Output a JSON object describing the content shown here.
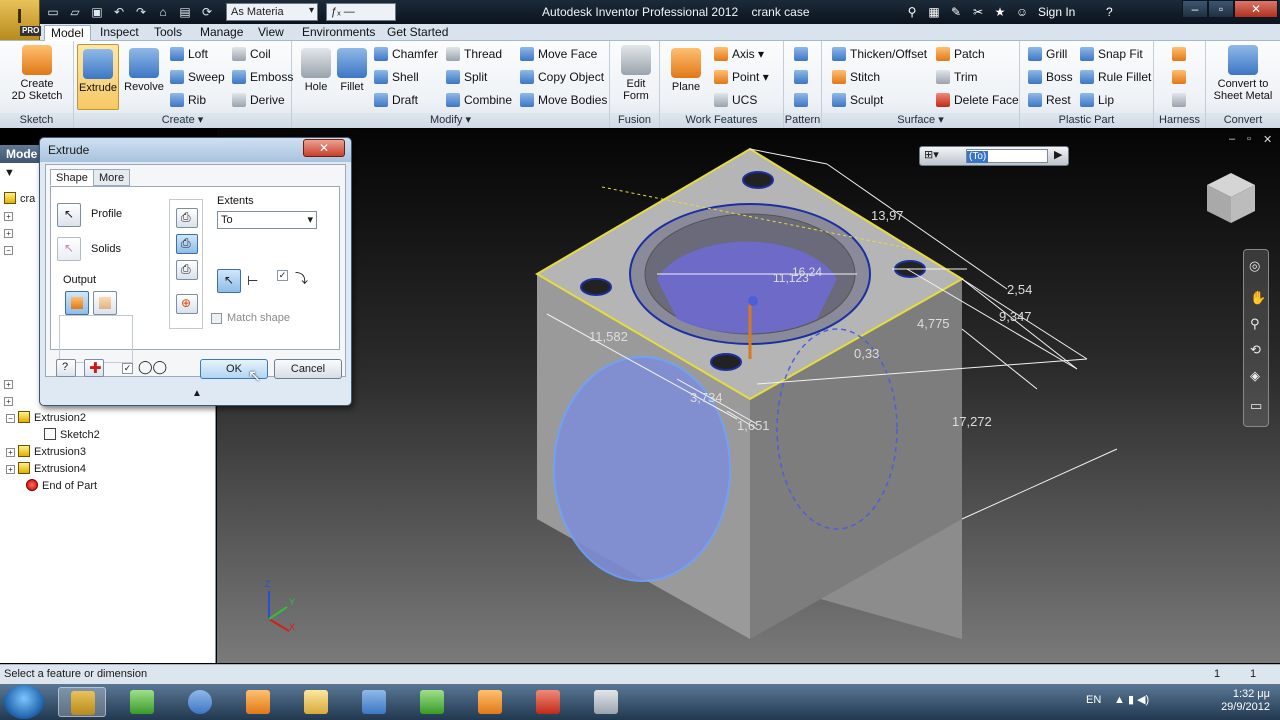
{
  "titlebar": {
    "app_title": "Autodesk Inventor Professional 2012",
    "document": "crank case",
    "material": "As Materia",
    "signin": "Sign In",
    "logo_badge": "PRO"
  },
  "tabs": [
    "Model",
    "Inspect",
    "Tools",
    "Manage",
    "View",
    "Environments",
    "Get Started"
  ],
  "ribbon": {
    "sketch": {
      "label": "Sketch",
      "create_line1": "Create",
      "create_line2": "2D Sketch"
    },
    "create": {
      "label": "Create",
      "extrude": "Extrude",
      "revolve": "Revolve",
      "small": [
        "Loft",
        "Sweep",
        "Rib",
        "Coil",
        "Emboss",
        "Derive"
      ]
    },
    "modify": {
      "label": "Modify",
      "hole": "Hole",
      "fillet": "Fillet",
      "small": [
        "Chamfer",
        "Shell",
        "Draft",
        "Thread",
        "Split",
        "Combine",
        "Move Face",
        "Copy Object",
        "Move Bodies"
      ]
    },
    "fusion": {
      "label": "Fusion",
      "edit_line1": "Edit",
      "edit_line2": "Form"
    },
    "work": {
      "label": "Work Features",
      "plane": "Plane",
      "small": [
        "Axis",
        "Point",
        "UCS"
      ]
    },
    "pattern": {
      "label": "Pattern"
    },
    "surface": {
      "label": "Surface",
      "small": [
        "Thicken/Offset",
        "Stitch",
        "Sculpt",
        "Patch",
        "Trim",
        "Delete Face"
      ]
    },
    "plastic": {
      "label": "Plastic Part",
      "small": [
        "Grill",
        "Boss",
        "Rest",
        "Snap Fit",
        "Rule Fillet",
        "Lip"
      ]
    },
    "harness": {
      "label": "Harness"
    },
    "convert": {
      "label": "Convert",
      "line1": "Convert to",
      "line2": "Sheet Metal"
    }
  },
  "browser": {
    "head": "Mode",
    "root": "cra",
    "items": [
      "Extrusion2",
      "Sketch2",
      "Extrusion3",
      "Extrusion4",
      "End of Part"
    ]
  },
  "dialog": {
    "title": "Extrude",
    "close": "✕",
    "tab_shape": "Shape",
    "tab_more": "More",
    "profile": "Profile",
    "solids": "Solids",
    "output": "Output",
    "extents": "Extents",
    "extent_value": "To",
    "match_shape": "Match shape",
    "ok": "OK",
    "cancel": "Cancel"
  },
  "viewport": {
    "mini_value": "(To)",
    "dims": [
      "13,97",
      "16,24",
      "11,123",
      "2,54",
      "9,347",
      "4,775",
      "0,33",
      "11,582",
      "3,734",
      "1,651",
      "17,272"
    ],
    "triad": {
      "z": "Z",
      "y": "Y",
      "x": "X"
    }
  },
  "status": {
    "text": "Select a feature or dimension",
    "n1": "1",
    "n2": "1"
  },
  "taskbar": {
    "lang": "EN",
    "time": "1:32 μμ",
    "date": "29/9/2012"
  }
}
